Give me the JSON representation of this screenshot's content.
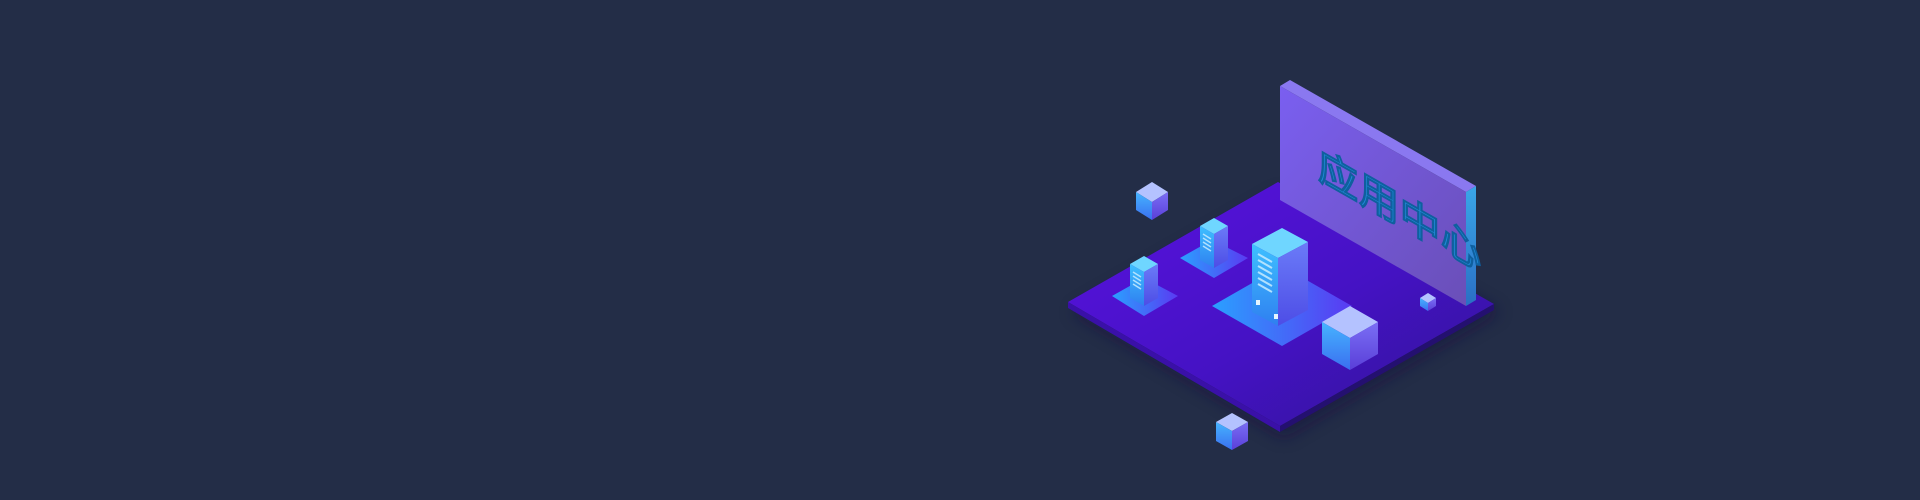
{
  "scene": {
    "sign_text": "应用中心",
    "icon_names": [
      "platform",
      "sign-wall",
      "server-tower",
      "floating-cube"
    ]
  },
  "colors": {
    "background": "#232d47",
    "platform_top": "#4a14c9",
    "platform_edge": "#2c1280",
    "wall_face": "#6f56de",
    "wall_side": "#2b8ed6",
    "cube_top": "#a8b8ff",
    "cube_left": "#3fa0ff",
    "cube_right": "#6d5cf0",
    "server_front": "#3b6cf5",
    "sign_text": "#1f8bd8"
  }
}
